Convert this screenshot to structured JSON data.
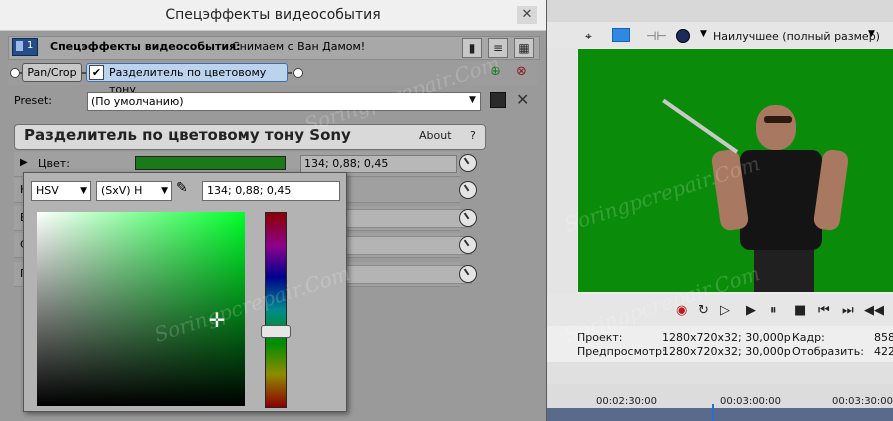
{
  "dialog": {
    "title": "Спецэффекты видеособытия",
    "close_icon": "close-icon",
    "badge": "1",
    "fx_label": "Спецэффекты видеособытия:",
    "fx_value": "Снимаем с Ван Дамом!",
    "chain": {
      "pan_crop": "Pan/Crop",
      "separator": "Разделитель по цветовому тону",
      "separator_checked": true
    },
    "preset": {
      "label": "Preset:",
      "value": "(По умолчанию)"
    },
    "plugin": {
      "title": "Разделитель по цветовому тону Sony",
      "about": "About",
      "help": "?"
    },
    "params": [
      {
        "label": "Цвет:",
        "value": "134; 0,88; 0,45",
        "swatch_color": "#1a7a1a"
      },
      {
        "label": "Н",
        "value": ""
      },
      {
        "label": "В",
        "value": ""
      },
      {
        "label": "С",
        "value": ""
      },
      {
        "label": "Г",
        "value": ""
      }
    ],
    "picker": {
      "mode": "HSV",
      "channel": "(SxV) H",
      "value": "134; 0,88; 0,45",
      "hue_color": "#00ff2a"
    }
  },
  "preview": {
    "quality": "Наилучшее (полный размер)",
    "project_label": "Проект:",
    "project_value": "1280x720x32; 30,000p",
    "preview_label": "Предпросмотр:",
    "preview_value": "1280x720x32; 30,000p",
    "frame_label": "Кадр:",
    "frame_value": "858",
    "display_label": "Отобразить:",
    "display_value": "422",
    "timeline_ticks": [
      "00:02:30:00",
      "00:03:00:00",
      "00:03:30:00"
    ]
  },
  "watermark": "Soringpcrepair.Com",
  "colors": {
    "accent": "#3f6fa6",
    "green_screen": "#0a8c0a"
  }
}
